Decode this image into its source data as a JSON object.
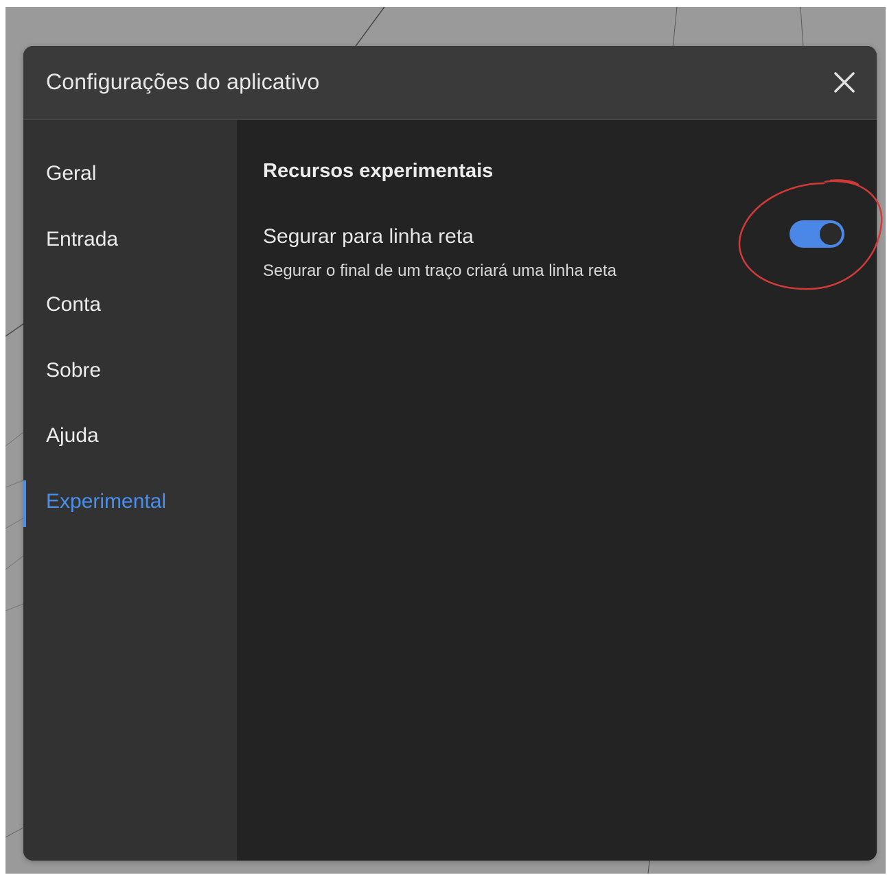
{
  "dialog": {
    "title": "Configurações do aplicativo",
    "close_icon": "close-icon"
  },
  "sidebar": {
    "items": [
      {
        "label": "Geral",
        "active": false
      },
      {
        "label": "Entrada",
        "active": false
      },
      {
        "label": "Conta",
        "active": false
      },
      {
        "label": "Sobre",
        "active": false
      },
      {
        "label": "Ajuda",
        "active": false
      },
      {
        "label": "Experimental",
        "active": true
      }
    ]
  },
  "content": {
    "section_title": "Recursos experimentais",
    "setting": {
      "title": "Segurar para linha reta",
      "description": "Segurar o final de um traço criará uma linha reta",
      "enabled": true
    }
  },
  "colors": {
    "accent": "#4b8fea",
    "annotation": "#d23a3a",
    "header_bg": "#3a3a3a",
    "sidebar_bg": "#323232",
    "content_bg": "#232323"
  }
}
